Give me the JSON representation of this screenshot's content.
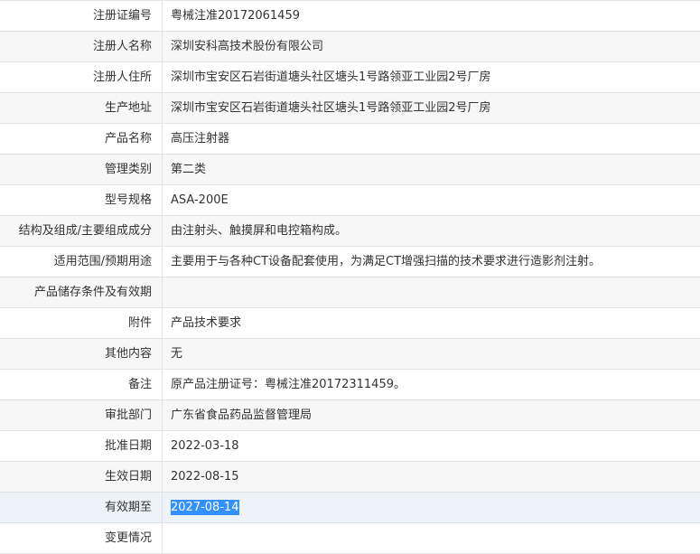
{
  "rows": [
    {
      "label": "注册证编号",
      "value": "粤械注准20172061459"
    },
    {
      "label": "注册人名称",
      "value": "深圳安科高技术股份有限公司"
    },
    {
      "label": "注册人住所",
      "value": "深圳市宝安区石岩街道塘头社区塘头1号路领亚工业园2号厂房"
    },
    {
      "label": "生产地址",
      "value": "深圳市宝安区石岩街道塘头社区塘头1号路领亚工业园2号厂房"
    },
    {
      "label": "产品名称",
      "value": "高压注射器"
    },
    {
      "label": "管理类别",
      "value": "第二类"
    },
    {
      "label": "型号规格",
      "value": "ASA-200E"
    },
    {
      "label": "结构及组成/主要组成成分",
      "value": "由注射头、触摸屏和电控箱构成。"
    },
    {
      "label": "适用范围/预期用途",
      "value": "主要用于与各种CT设备配套使用，为满足CT增强扫描的技术要求进行造影剂注射。"
    },
    {
      "label": "产品储存条件及有效期",
      "value": ""
    },
    {
      "label": "附件",
      "value": "产品技术要求"
    },
    {
      "label": "其他内容",
      "value": "无"
    },
    {
      "label": "备注",
      "value": "原产品注册证号：粤械注准20172311459。"
    },
    {
      "label": "审批部门",
      "value": "广东省食品药品监督管理局"
    },
    {
      "label": "批准日期",
      "value": "2022-03-18"
    },
    {
      "label": "生效日期",
      "value": "2022-08-15"
    },
    {
      "label": "有效期至",
      "value": "2027-08-14"
    },
    {
      "label": "变更情况",
      "value": ""
    }
  ],
  "selection": {
    "color": "#3390ff"
  }
}
